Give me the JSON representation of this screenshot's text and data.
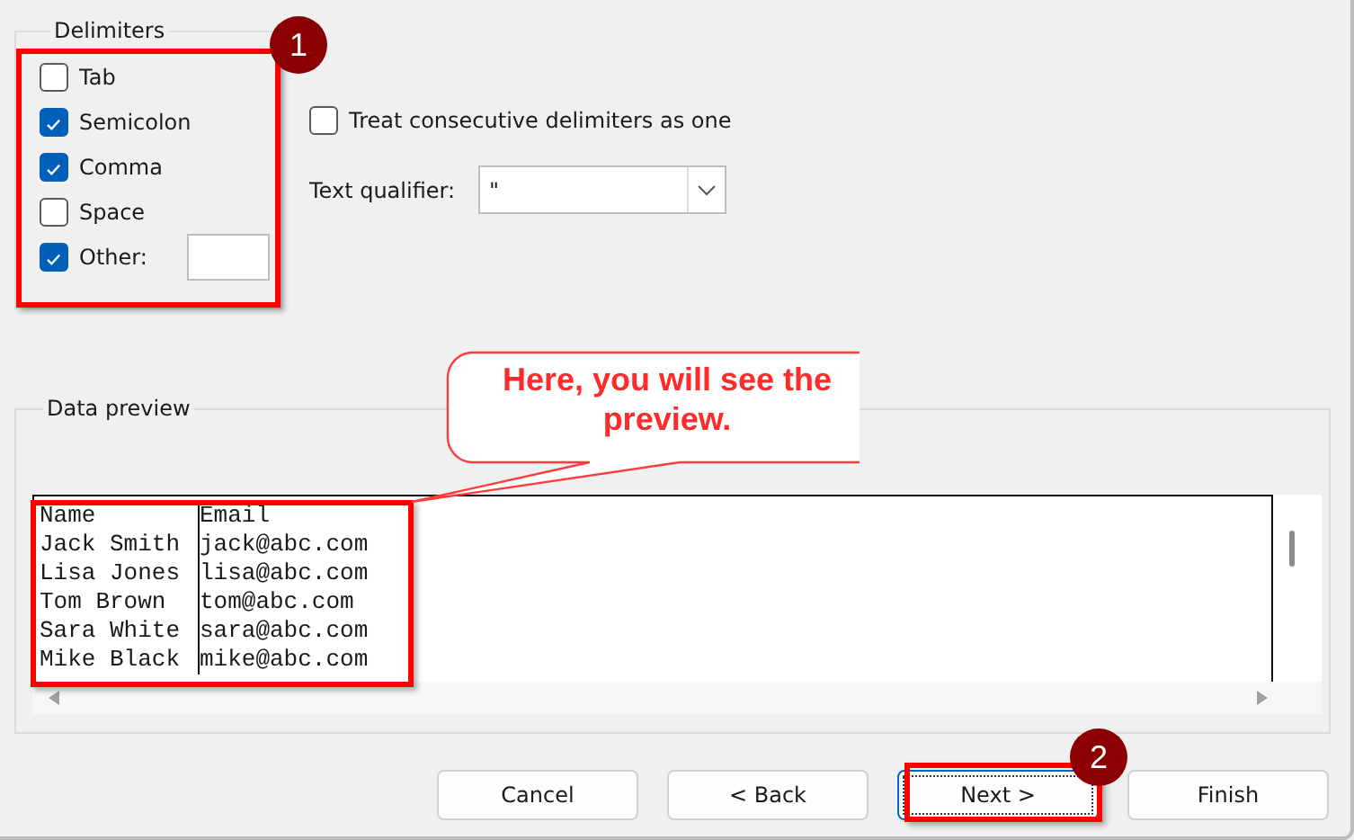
{
  "delimiters": {
    "title": "Delimiters",
    "options": [
      {
        "label": "Tab",
        "checked": false,
        "kind": "plain"
      },
      {
        "label": "Semicolon",
        "checked": true,
        "kind": "plain"
      },
      {
        "label": "Comma",
        "checked": true,
        "kind": "plain"
      },
      {
        "label": "Space",
        "checked": false,
        "kind": "plain"
      },
      {
        "label": "Other:",
        "checked": true,
        "kind": "with_field"
      }
    ]
  },
  "consecutive": {
    "label": "Treat consecutive delimiters as one",
    "checked": false
  },
  "text_qualifier": {
    "label": "Text qualifier:",
    "value": "\""
  },
  "data_preview": {
    "title": "Data preview",
    "rows": [
      [
        "Name",
        "Email"
      ],
      [
        "Jack Smith",
        "jack@abc.com"
      ],
      [
        "Lisa Jones",
        "lisa@abc.com"
      ],
      [
        "Tom Brown",
        "tom@abc.com"
      ],
      [
        "Sara White",
        "sara@abc.com"
      ],
      [
        "Mike Black",
        "mike@abc.com"
      ]
    ]
  },
  "buttons": [
    {
      "label": "Cancel",
      "focused": false
    },
    {
      "label": "< Back",
      "focused": false
    },
    {
      "label": "Next >",
      "focused": true
    },
    {
      "label": "Finish",
      "focused": false
    }
  ],
  "annotations": {
    "callout": "Here, you will see the preview.",
    "badges": [
      "1",
      "2"
    ]
  }
}
